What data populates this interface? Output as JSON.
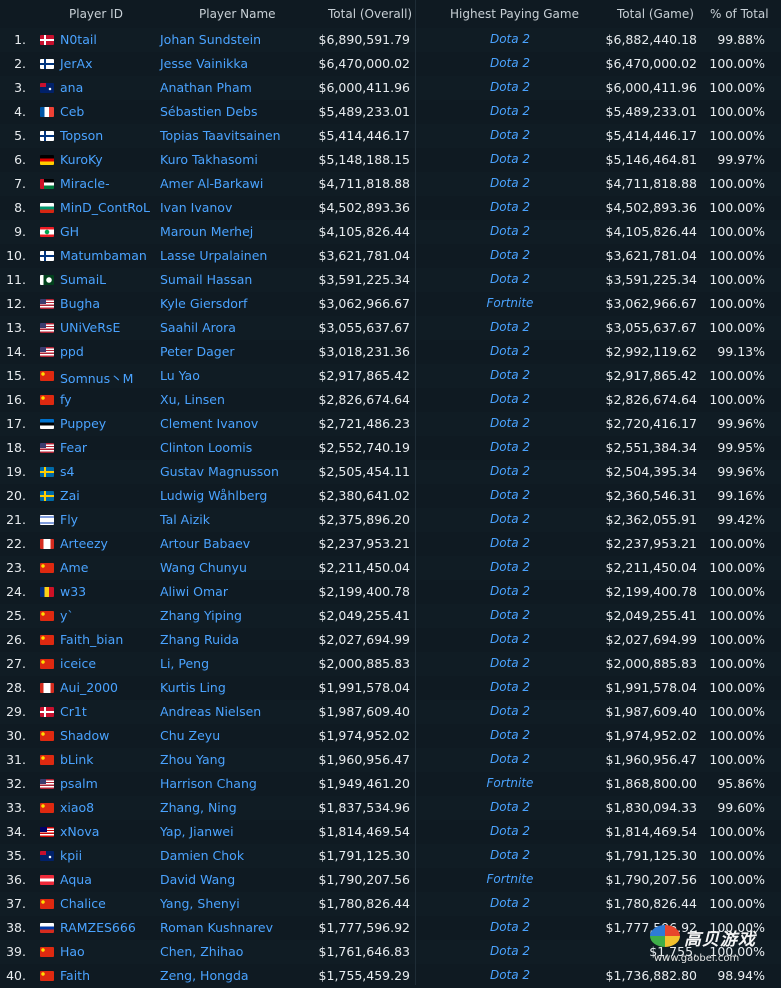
{
  "headers": {
    "player_id": "Player ID",
    "player_name": "Player Name",
    "total_overall": "Total (Overall)",
    "highest_game": "Highest Paying Game",
    "total_game": "Total (Game)",
    "pct_total": "% of Total"
  },
  "rows": [
    {
      "rank": "1.",
      "flag": "denmark",
      "id": "N0tail",
      "name": "Johan Sundstein",
      "total": "$6,890,591.79",
      "game": "Dota 2",
      "game_total": "$6,882,440.18",
      "pct": "99.88%"
    },
    {
      "rank": "2.",
      "flag": "finland",
      "id": "JerAx",
      "name": "Jesse Vainikka",
      "total": "$6,470,000.02",
      "game": "Dota 2",
      "game_total": "$6,470,000.02",
      "pct": "100.00%"
    },
    {
      "rank": "3.",
      "flag": "australia",
      "id": "ana",
      "name": "Anathan Pham",
      "total": "$6,000,411.96",
      "game": "Dota 2",
      "game_total": "$6,000,411.96",
      "pct": "100.00%"
    },
    {
      "rank": "4.",
      "flag": "france",
      "id": "Ceb",
      "name": "Sébastien Debs",
      "total": "$5,489,233.01",
      "game": "Dota 2",
      "game_total": "$5,489,233.01",
      "pct": "100.00%"
    },
    {
      "rank": "5.",
      "flag": "finland",
      "id": "Topson",
      "name": "Topias Taavitsainen",
      "total": "$5,414,446.17",
      "game": "Dota 2",
      "game_total": "$5,414,446.17",
      "pct": "100.00%"
    },
    {
      "rank": "6.",
      "flag": "germany",
      "id": "KuroKy",
      "name": "Kuro Takhasomi",
      "total": "$5,148,188.15",
      "game": "Dota 2",
      "game_total": "$5,146,464.81",
      "pct": "99.97%"
    },
    {
      "rank": "7.",
      "flag": "jordan",
      "id": "Miracle-",
      "name": "Amer Al-Barkawi",
      "total": "$4,711,818.88",
      "game": "Dota 2",
      "game_total": "$4,711,818.88",
      "pct": "100.00%"
    },
    {
      "rank": "8.",
      "flag": "bulgaria",
      "id": "MinD_ContRoL",
      "name": "Ivan Ivanov",
      "total": "$4,502,893.36",
      "game": "Dota 2",
      "game_total": "$4,502,893.36",
      "pct": "100.00%"
    },
    {
      "rank": "9.",
      "flag": "lebanon",
      "id": "GH",
      "name": "Maroun Merhej",
      "total": "$4,105,826.44",
      "game": "Dota 2",
      "game_total": "$4,105,826.44",
      "pct": "100.00%"
    },
    {
      "rank": "10.",
      "flag": "finland",
      "id": "Matumbaman",
      "name": "Lasse Urpalainen",
      "total": "$3,621,781.04",
      "game": "Dota 2",
      "game_total": "$3,621,781.04",
      "pct": "100.00%"
    },
    {
      "rank": "11.",
      "flag": "pakistan",
      "id": "SumaiL",
      "name": "Sumail Hassan",
      "total": "$3,591,225.34",
      "game": "Dota 2",
      "game_total": "$3,591,225.34",
      "pct": "100.00%"
    },
    {
      "rank": "12.",
      "flag": "usa",
      "id": "Bugha",
      "name": "Kyle Giersdorf",
      "total": "$3,062,966.67",
      "game": "Fortnite",
      "game_total": "$3,062,966.67",
      "pct": "100.00%"
    },
    {
      "rank": "13.",
      "flag": "usa",
      "id": "UNiVeRsE",
      "name": "Saahil Arora",
      "total": "$3,055,637.67",
      "game": "Dota 2",
      "game_total": "$3,055,637.67",
      "pct": "100.00%"
    },
    {
      "rank": "14.",
      "flag": "usa",
      "id": "ppd",
      "name": "Peter Dager",
      "total": "$3,018,231.36",
      "game": "Dota 2",
      "game_total": "$2,992,119.62",
      "pct": "99.13%"
    },
    {
      "rank": "15.",
      "flag": "china",
      "id": "Somnus丶M",
      "name": "Lu Yao",
      "total": "$2,917,865.42",
      "game": "Dota 2",
      "game_total": "$2,917,865.42",
      "pct": "100.00%"
    },
    {
      "rank": "16.",
      "flag": "china",
      "id": "fy",
      "name": "Xu, Linsen",
      "total": "$2,826,674.64",
      "game": "Dota 2",
      "game_total": "$2,826,674.64",
      "pct": "100.00%"
    },
    {
      "rank": "17.",
      "flag": "estonia",
      "id": "Puppey",
      "name": "Clement Ivanov",
      "total": "$2,721,486.23",
      "game": "Dota 2",
      "game_total": "$2,720,416.17",
      "pct": "99.96%"
    },
    {
      "rank": "18.",
      "flag": "usa",
      "id": "Fear",
      "name": "Clinton Loomis",
      "total": "$2,552,740.19",
      "game": "Dota 2",
      "game_total": "$2,551,384.34",
      "pct": "99.95%"
    },
    {
      "rank": "19.",
      "flag": "sweden",
      "id": "s4",
      "name": "Gustav Magnusson",
      "total": "$2,505,454.11",
      "game": "Dota 2",
      "game_total": "$2,504,395.34",
      "pct": "99.96%"
    },
    {
      "rank": "20.",
      "flag": "sweden",
      "id": "Zai",
      "name": "Ludwig Wåhlberg",
      "total": "$2,380,641.02",
      "game": "Dota 2",
      "game_total": "$2,360,546.31",
      "pct": "99.16%"
    },
    {
      "rank": "21.",
      "flag": "israel",
      "id": "Fly",
      "name": "Tal Aizik",
      "total": "$2,375,896.20",
      "game": "Dota 2",
      "game_total": "$2,362,055.91",
      "pct": "99.42%"
    },
    {
      "rank": "22.",
      "flag": "canada",
      "id": "Arteezy",
      "name": "Artour Babaev",
      "total": "$2,237,953.21",
      "game": "Dota 2",
      "game_total": "$2,237,953.21",
      "pct": "100.00%"
    },
    {
      "rank": "23.",
      "flag": "china",
      "id": "Ame",
      "name": "Wang Chunyu",
      "total": "$2,211,450.04",
      "game": "Dota 2",
      "game_total": "$2,211,450.04",
      "pct": "100.00%"
    },
    {
      "rank": "24.",
      "flag": "romania",
      "id": "w33",
      "name": "Aliwi Omar",
      "total": "$2,199,400.78",
      "game": "Dota 2",
      "game_total": "$2,199,400.78",
      "pct": "100.00%"
    },
    {
      "rank": "25.",
      "flag": "china",
      "id": "y`",
      "name": "Zhang Yiping",
      "total": "$2,049,255.41",
      "game": "Dota 2",
      "game_total": "$2,049,255.41",
      "pct": "100.00%"
    },
    {
      "rank": "26.",
      "flag": "china",
      "id": "Faith_bian",
      "name": "Zhang Ruida",
      "total": "$2,027,694.99",
      "game": "Dota 2",
      "game_total": "$2,027,694.99",
      "pct": "100.00%"
    },
    {
      "rank": "27.",
      "flag": "china",
      "id": "iceice",
      "name": "Li, Peng",
      "total": "$2,000,885.83",
      "game": "Dota 2",
      "game_total": "$2,000,885.83",
      "pct": "100.00%"
    },
    {
      "rank": "28.",
      "flag": "canada",
      "id": "Aui_2000",
      "name": "Kurtis Ling",
      "total": "$1,991,578.04",
      "game": "Dota 2",
      "game_total": "$1,991,578.04",
      "pct": "100.00%"
    },
    {
      "rank": "29.",
      "flag": "denmark",
      "id": "Cr1t",
      "name": "Andreas Nielsen",
      "total": "$1,987,609.40",
      "game": "Dota 2",
      "game_total": "$1,987,609.40",
      "pct": "100.00%"
    },
    {
      "rank": "30.",
      "flag": "china",
      "id": "Shadow",
      "name": "Chu Zeyu",
      "total": "$1,974,952.02",
      "game": "Dota 2",
      "game_total": "$1,974,952.02",
      "pct": "100.00%"
    },
    {
      "rank": "31.",
      "flag": "china",
      "id": "bLink",
      "name": "Zhou Yang",
      "total": "$1,960,956.47",
      "game": "Dota 2",
      "game_total": "$1,960,956.47",
      "pct": "100.00%"
    },
    {
      "rank": "32.",
      "flag": "usa",
      "id": "psalm",
      "name": "Harrison Chang",
      "total": "$1,949,461.20",
      "game": "Fortnite",
      "game_total": "$1,868,800.00",
      "pct": "95.86%"
    },
    {
      "rank": "33.",
      "flag": "china",
      "id": "xiao8",
      "name": "Zhang, Ning",
      "total": "$1,837,534.96",
      "game": "Dota 2",
      "game_total": "$1,830,094.33",
      "pct": "99.60%"
    },
    {
      "rank": "34.",
      "flag": "malaysia",
      "id": "xNova",
      "name": "Yap, Jianwei",
      "total": "$1,814,469.54",
      "game": "Dota 2",
      "game_total": "$1,814,469.54",
      "pct": "100.00%"
    },
    {
      "rank": "35.",
      "flag": "australia",
      "id": "kpii",
      "name": "Damien Chok",
      "total": "$1,791,125.30",
      "game": "Dota 2",
      "game_total": "$1,791,125.30",
      "pct": "100.00%"
    },
    {
      "rank": "36.",
      "flag": "austria",
      "id": "Aqua",
      "name": "David Wang",
      "total": "$1,790,207.56",
      "game": "Fortnite",
      "game_total": "$1,790,207.56",
      "pct": "100.00%"
    },
    {
      "rank": "37.",
      "flag": "china",
      "id": "Chalice",
      "name": "Yang, Shenyi",
      "total": "$1,780,826.44",
      "game": "Dota 2",
      "game_total": "$1,780,826.44",
      "pct": "100.00%"
    },
    {
      "rank": "38.",
      "flag": "russia",
      "id": "RAMZES666",
      "name": "Roman Kushnarev",
      "total": "$1,777,596.92",
      "game": "Dota 2",
      "game_total": "$1,777,596.92",
      "pct": "100.00%"
    },
    {
      "rank": "39.",
      "flag": "china",
      "id": "Hao",
      "name": "Chen, Zhihao",
      "total": "$1,761,646.83",
      "game": "Dota 2",
      "game_total": "$1,755,",
      "pct": "100.00%"
    },
    {
      "rank": "40.",
      "flag": "china",
      "id": "Faith",
      "name": "Zeng, Hongda",
      "total": "$1,755,459.29",
      "game": "Dota 2",
      "game_total": "$1,736,882.80",
      "pct": "98.94%"
    }
  ],
  "watermark": {
    "url": "www.gaobei.com"
  },
  "colors": {
    "background": "#0f1a22",
    "link": "#4aa3ff",
    "text": "#e8ecef"
  }
}
